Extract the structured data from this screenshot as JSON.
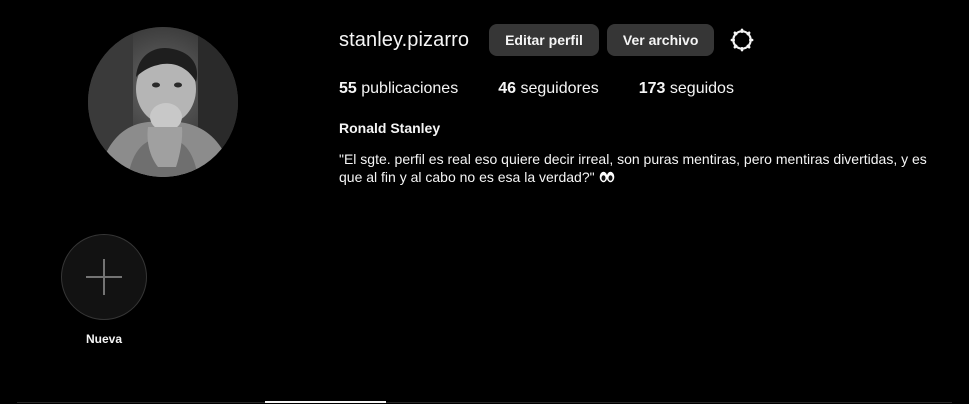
{
  "profile": {
    "username": "stanley.pizarro",
    "full_name": "Ronald Stanley",
    "bio": "\"El sgte. perfil es real eso quiere decir irreal, son puras mentiras, pero mentiras divertidas, y es que al fin y al cabo no es esa la verdad?\"",
    "bio_emoji_icon": "eyes-icon"
  },
  "buttons": {
    "edit_profile": "Editar perfil",
    "view_archive": "Ver archivo",
    "settings_icon": "gear-icon"
  },
  "stats": {
    "posts_count": "55",
    "posts_label": "publicaciones",
    "followers_count": "46",
    "followers_label": "seguidores",
    "following_count": "173",
    "following_label": "seguidos"
  },
  "highlights": {
    "new_label": "Nueva",
    "new_icon": "plus-icon"
  },
  "colors": {
    "background": "#000000",
    "button_bg": "#363636",
    "text": "#f5f5f5"
  }
}
